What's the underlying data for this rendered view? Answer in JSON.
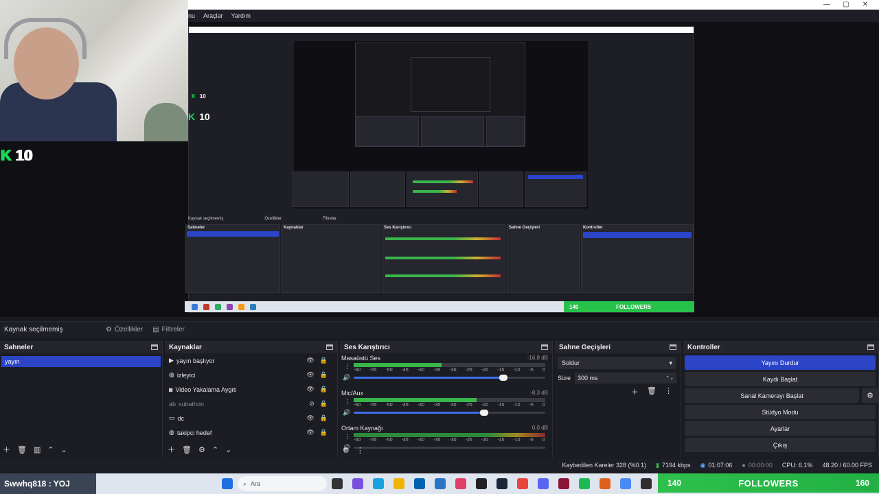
{
  "menu": {
    "items": [
      "nu",
      "Araçlar",
      "Yardım"
    ]
  },
  "webcam": {
    "counter": "10"
  },
  "preview": {
    "counter_main": "10",
    "counter_nested": "10",
    "nested_counter_small": "10"
  },
  "nested_ui": {
    "source_label": "Kaynak seçilmemiş",
    "tb_props": "Özellikler",
    "tb_filters": "Filtreler",
    "scenes": "Sahneler",
    "sources": "Kaynaklar",
    "mixer": "Ses Karıştırıcı",
    "transitions": "Sahne Geçişleri",
    "controls": "Kontroller",
    "followers_label": "FOLLOWERS",
    "followers_count": "140"
  },
  "sourcebar": {
    "label": "Kaynak seçilmemiş",
    "props": "Özellikler",
    "filters": "Filtreler"
  },
  "scenes": {
    "title": "Sahneler",
    "items": [
      "yayın"
    ]
  },
  "sources": {
    "title": "Kaynaklar",
    "items": [
      {
        "label": "yayın başlıyor",
        "icon": "play-icon"
      },
      {
        "label": "izleyici",
        "icon": "browser-icon"
      },
      {
        "label": "Video Yakalama Aygıtı",
        "icon": "camera-icon"
      },
      {
        "label": "subathon",
        "icon": "text-icon"
      },
      {
        "label": "dc",
        "icon": "window-icon"
      },
      {
        "label": "takipci hedef",
        "icon": "browser-icon"
      }
    ]
  },
  "mixer": {
    "title": "Ses Karıştırıcı",
    "channels": [
      {
        "name": "Masaüstü Ses",
        "db": "-16.8 dB",
        "level": 0.46,
        "volume": 0.78
      },
      {
        "name": "Mic/Aux",
        "db": "-8.3 dB",
        "level": 0.64,
        "volume": 0.68
      },
      {
        "name": "Ortam Kaynağı",
        "db": "0.0 dB",
        "level": 1.0,
        "volume": 0.0
      }
    ],
    "scale": [
      "-60",
      "-55",
      "-50",
      "-45",
      "-40",
      "-35",
      "-30",
      "-25",
      "-20",
      "-15",
      "-10",
      "-5",
      "0"
    ]
  },
  "transitions": {
    "title": "Sahne Geçişleri",
    "selected": "Soldur",
    "duration_label": "Süre",
    "duration_value": "300 ms"
  },
  "controls": {
    "title": "Kontroller",
    "buttons": [
      "Yayını Durdur",
      "Kaydı Başlat",
      "Sanal Kamerayı Başlat",
      "Stüdyo Modu",
      "Ayarlar",
      "Çıkış"
    ]
  },
  "stats": {
    "dropped": "Kaybedilen Kareler 328 (%0.1)",
    "bitrate": "7194 kbps",
    "live_time": "01:07:06",
    "rec_time": "00:00:00",
    "cpu": "CPU: 6.1%",
    "fps": "48.20 / 60.00 FPS"
  },
  "taskbar": {
    "user": "Swwhq818 : YOJ",
    "search_placeholder": "Ara",
    "followers_count": "140",
    "followers_label": "FOLLOWERS",
    "followers_goal": "160"
  },
  "colors": {
    "accent": "#2b44c8",
    "green": "#2ec04c",
    "counter_k": "#19d85a"
  }
}
